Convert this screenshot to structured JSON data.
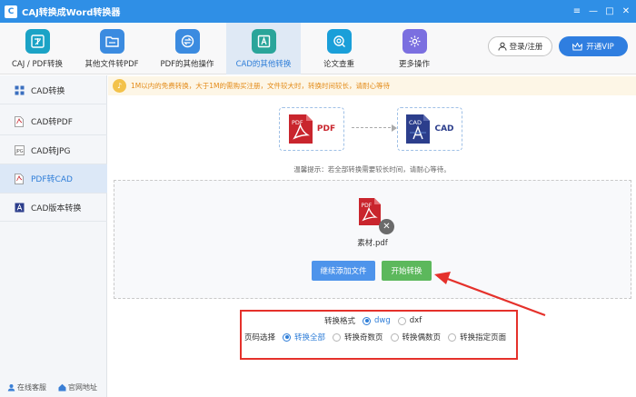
{
  "window": {
    "title": "CAJ转换成Word转换器",
    "controls": [
      "≡",
      "—",
      "□",
      "✕"
    ]
  },
  "toolbar": {
    "tools": [
      {
        "label": "CAJ / PDF转换",
        "icon": "caj-pdf-convert-icon",
        "color": "#1ba3c6",
        "glyph": "文"
      },
      {
        "label": "其他文件转PDF",
        "icon": "folder-icon",
        "color": "#3b8be0",
        "glyph": "▭"
      },
      {
        "label": "PDF的其他操作",
        "icon": "swap-icon",
        "color": "#3b8be0",
        "glyph": "⇄"
      },
      {
        "label": "CAD的其他转换",
        "icon": "cad-convert-icon",
        "color": "#2aa59a",
        "glyph": "A"
      },
      {
        "label": "论文查重",
        "icon": "search-doc-icon",
        "color": "#1a9fd9",
        "glyph": "◎"
      },
      {
        "label": "更多操作",
        "icon": "gear-icon",
        "color": "#7b6fe0",
        "glyph": "⚙"
      }
    ],
    "active_index": 3,
    "login_label": "登录/注册",
    "vip_label": "开通VIP"
  },
  "sidebar": {
    "items": [
      {
        "label": "CAD转换",
        "icon": "grid-icon"
      },
      {
        "label": "CAD转PDF",
        "icon": "pdf-file-icon"
      },
      {
        "label": "CAD转JPG",
        "icon": "jpg-file-icon"
      },
      {
        "label": "PDF转CAD",
        "icon": "pdf-cad-icon"
      },
      {
        "label": "CAD版本转换",
        "icon": "cad-version-icon"
      }
    ],
    "active_index": 3,
    "footer": {
      "service": "在线客服",
      "website": "官网地址"
    }
  },
  "notice": {
    "text": "1M以内的免费转换，大于1M的需购买注册，文件较大时，转换时间较长，请耐心等待"
  },
  "conversion": {
    "from_label": "PDF",
    "to_label": "CAD",
    "from_icon_text": "PDF",
    "to_icon_text": "CAD",
    "tip": "温馨提示：若全部转换需要较长时间，请耐心等待。"
  },
  "file": {
    "name": "素材.pdf",
    "icon_text": "PDF",
    "remove_glyph": "✕"
  },
  "buttons": {
    "add_more": "继续添加文件",
    "start": "开始转换"
  },
  "options": {
    "format_label": "转换格式",
    "formats": [
      {
        "label": "dwg",
        "selected": true
      },
      {
        "label": "dxf",
        "selected": false
      }
    ],
    "pages_label": "页码选择",
    "pages": [
      {
        "label": "转换全部",
        "selected": true
      },
      {
        "label": "转换奇数页",
        "selected": false
      },
      {
        "label": "转换偶数页",
        "selected": false
      },
      {
        "label": "转换指定页面",
        "selected": false
      }
    ]
  },
  "colors": {
    "accent": "#2f7ed8",
    "titlebar": "#2f8fe6",
    "pdf_red": "#c9252d",
    "cad_navy": "#2c3e8c",
    "start_green": "#5cb85c",
    "highlight_red": "#e5312b"
  }
}
